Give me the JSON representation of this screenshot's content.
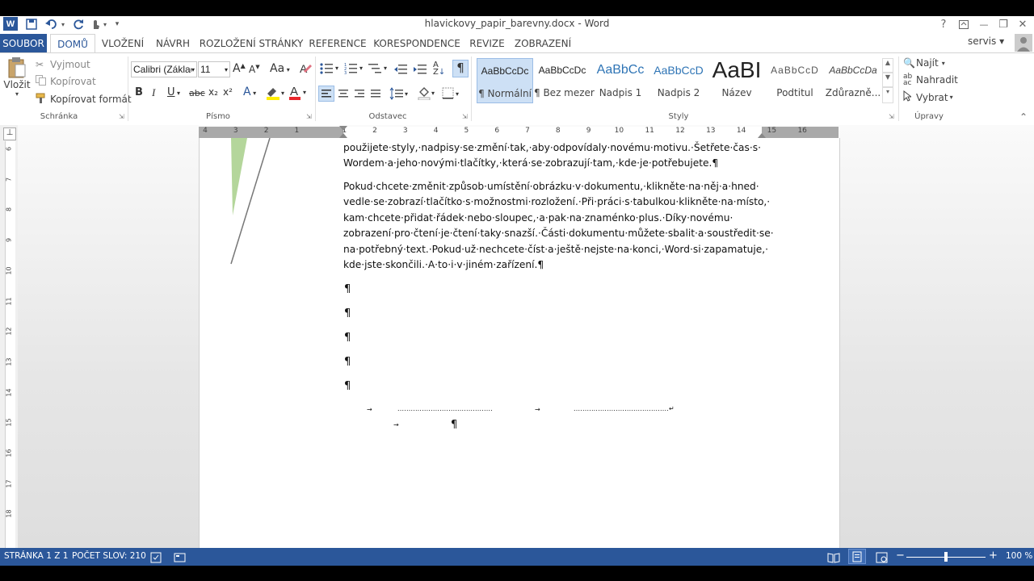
{
  "window": {
    "title": "hlavickovy_papir_barevny.docx - Word",
    "help_label": "?",
    "minimize_label": "—",
    "restore_label": "❐",
    "close_label": "✕"
  },
  "tabs": [
    "SOUBOR",
    "DOMŮ",
    "VLOŽENÍ",
    "NÁVRH",
    "ROZLOŽENÍ STRÁNKY",
    "REFERENCE",
    "KORESPONDENCE",
    "REVIZE",
    "ZOBRAZENÍ"
  ],
  "user": {
    "name": "servis"
  },
  "clipboard": {
    "paste_label": "Vložit",
    "cut_label": "Vyjmout",
    "copy_label": "Kopírovat",
    "format_painter_label": "Kopírovat formát",
    "group_label": "Schránka"
  },
  "font": {
    "font_name": "Calibri (Základ",
    "font_size": "11",
    "group_label": "Písmo",
    "bold": "B",
    "italic": "I",
    "underline": "U",
    "strike": "abc",
    "subscript": "x₂",
    "superscript": "x²",
    "grow": "A",
    "shrink": "A",
    "case": "Aa"
  },
  "paragraph": {
    "group_label": "Odstavec",
    "pilcrow": "¶"
  },
  "styles": {
    "group_label": "Styly",
    "items": [
      {
        "preview": "AaBbCcDc",
        "name": "¶ Normální"
      },
      {
        "preview": "AaBbCcDc",
        "name": "¶ Bez mezer"
      },
      {
        "preview": "AaBbCc",
        "name": "Nadpis 1"
      },
      {
        "preview": "AaBbCcD",
        "name": "Nadpis 2"
      },
      {
        "preview": "AaBI",
        "name": "Název"
      },
      {
        "preview": "AaBbCcD",
        "name": "Podtitul"
      },
      {
        "preview": "AaBbCcDa",
        "name": "Zdůrazně..."
      }
    ]
  },
  "editing": {
    "group_label": "Úpravy",
    "find_label": "Najít",
    "replace_label": "Nahradit",
    "select_label": "Vybrat"
  },
  "ruler": {
    "h_ticks": [
      "4",
      "3",
      "2",
      "1",
      "1",
      "2",
      "3",
      "4",
      "5",
      "6",
      "7",
      "8",
      "9",
      "10",
      "11",
      "12",
      "13",
      "14",
      "15",
      "16"
    ],
    "v_ticks": [
      "6",
      "7",
      "8",
      "9",
      "10",
      "11",
      "12",
      "13",
      "14",
      "15",
      "16",
      "17",
      "18"
    ]
  },
  "document": {
    "para1": [
      "použijete·styly,·nadpisy·se·změní·tak,·aby·odpovídaly·novému·motivu.·Šetřete·čas·s·",
      "Wordem·a·jeho·novými·tlačítky,·která·se·zobrazují·tam,·kde·je·potřebujete.¶"
    ],
    "para2": [
      "Pokud·chcete·změnit·způsob·umístění·obrázku·v·dokumentu,·klikněte·na·něj·a·hned·",
      "vedle·se·zobrazí·tlačítko·s·možnostmi·rozložení.·Při·práci·s·tabulkou·klikněte·na·místo,·",
      "kam·chcete·přidat·řádek·nebo·sloupec,·a·pak·na·znaménko·plus.·Díky·novému·",
      "zobrazení·pro·čtení·je·čtení·taky·snazší.·Části·dokumentu·můžete·sbalit·a·soustředit·se·",
      "na·potřebný·text.·Pokud·už·nechcete·číst·a·ještě·nejste·na·konci,·Word·si·zapamatuje,·",
      "kde·jste·skončili.·A·to·i·v·jiném·zařízení.¶"
    ],
    "empty_marks": [
      "¶",
      "¶",
      "¶",
      "¶",
      "¶"
    ],
    "tab_arrow": "→",
    "dots1": "...........................................",
    "dots2": "...........................................↵",
    "end_mark": "¶"
  },
  "status": {
    "page": "STRÁNKA 1 Z 1",
    "words": "POČET SLOV: 210",
    "zoom_minus": "−",
    "zoom_plus": "+",
    "zoom": "100 %"
  },
  "colors": {
    "brand": "#2b579a",
    "accent_shape": "#a7cf8a"
  }
}
